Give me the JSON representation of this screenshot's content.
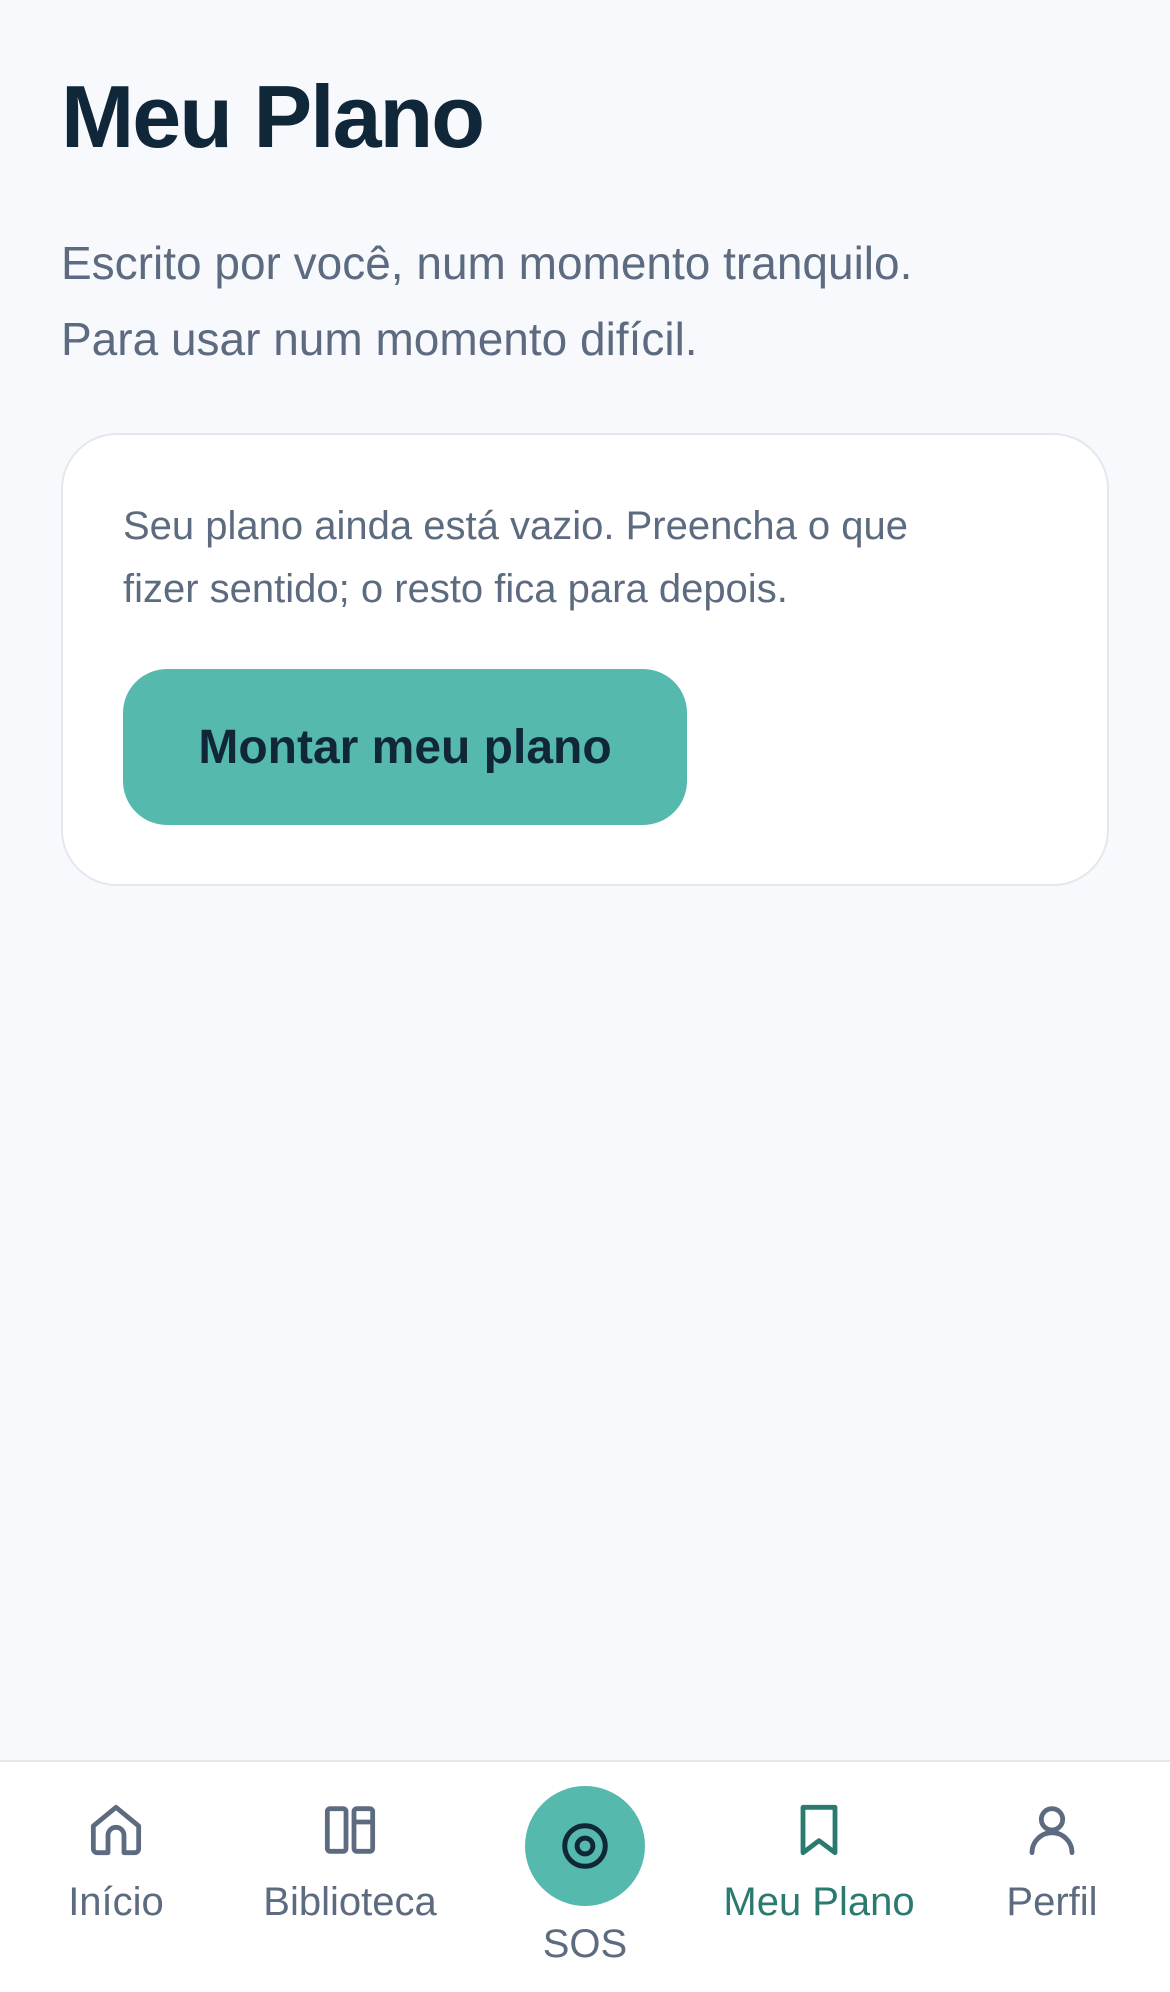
{
  "header": {
    "title": "Meu Plano",
    "subtitle_line1": "Escrito por você, num momento tranquilo.",
    "subtitle_line2": "Para usar num momento difícil."
  },
  "plan_card": {
    "message_line1": "Seu plano ainda está vazio. Preencha o que",
    "message_line2": "fizer sentido; o resto fica para depois.",
    "button_label": "Montar meu plano"
  },
  "bottom_nav": {
    "items": [
      {
        "label": "Início",
        "icon": "home-icon"
      },
      {
        "label": "Biblioteca",
        "icon": "library-icon"
      },
      {
        "label": "SOS",
        "icon": "sos-icon"
      },
      {
        "label": "Meu Plano",
        "icon": "bookmark-icon",
        "active": true
      },
      {
        "label": "Perfil",
        "icon": "user-icon"
      }
    ]
  },
  "colors": {
    "background": "#f7f9fc",
    "accent": "#55b9ae",
    "active_nav": "#2b7a6f",
    "title_text": "#10273a",
    "body_text": "#5d6b80"
  }
}
